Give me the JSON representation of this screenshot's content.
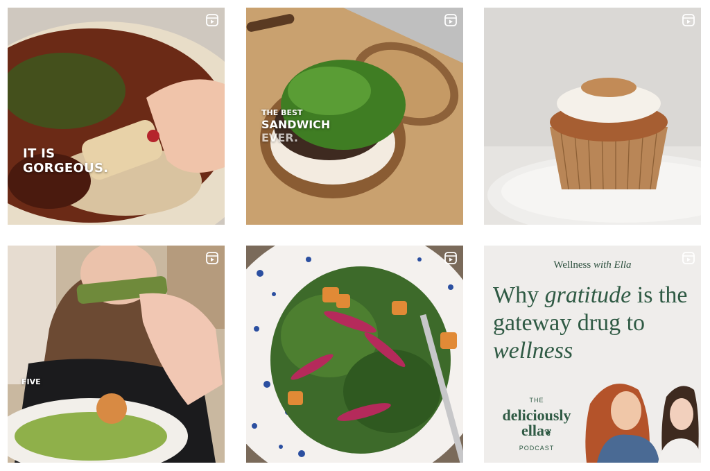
{
  "grid": {
    "tiles": [
      {
        "overlay_lines": [
          "IT IS",
          "GORGEOUS."
        ],
        "icon": "reel-icon"
      },
      {
        "overlay_lines": [
          "THE BEST",
          "SANDWICH",
          "EVER."
        ],
        "icon": "reel-icon"
      },
      {
        "icon": "reel-icon"
      },
      {
        "overlay_lines": [
          "FIVE"
        ],
        "icon": "reel-icon"
      },
      {
        "icon": "reel-icon"
      },
      {
        "icon": "reel-icon",
        "podcast_label_plain": "Wellness",
        "podcast_label_italic": "with Ella",
        "headline_part1": "Why",
        "headline_italic1": "gratitude",
        "headline_part2": "is the gateway drug to",
        "headline_italic2": "wellness",
        "brand_top": "THE",
        "brand_name_line1": "deliciously",
        "brand_name_line2": "ella",
        "brand_bottom": "PODCAST"
      }
    ]
  },
  "colors": {
    "brand_green": "#2f5a44",
    "podcast_bg": "#efedeb"
  }
}
